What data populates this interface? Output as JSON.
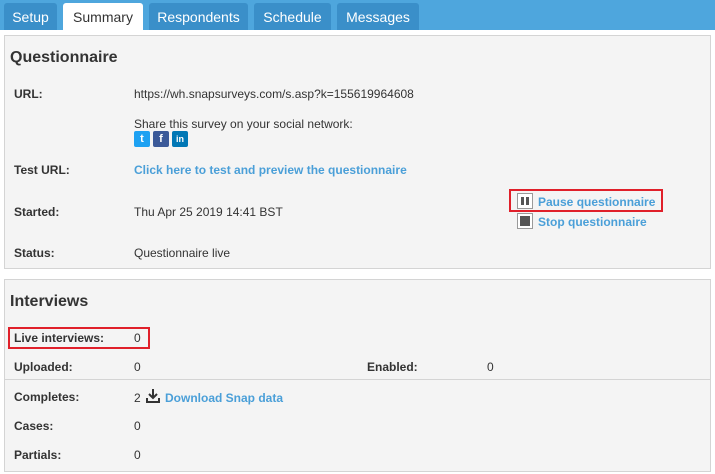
{
  "tabs": [
    {
      "label": "Setup"
    },
    {
      "label": "Summary"
    },
    {
      "label": "Respondents"
    },
    {
      "label": "Schedule"
    },
    {
      "label": "Messages"
    }
  ],
  "questionnaire": {
    "title": "Questionnaire",
    "url_label": "URL:",
    "url_value": "https://wh.snapsurveys.com/s.asp?k=155619964608",
    "share_text": "Share this survey on your social network:",
    "social": {
      "twitter": "t",
      "facebook": "f",
      "linkedin": "in"
    },
    "test_url_label": "Test URL:",
    "test_url_link": "Click here to test and preview the questionnaire",
    "started_label": "Started:",
    "started_value": "Thu Apr 25 2019 14:41 BST",
    "status_label": "Status:",
    "status_value": "Questionnaire live",
    "pause_label": "Pause questionnaire",
    "stop_label": "Stop questionnaire"
  },
  "interviews": {
    "title": "Interviews",
    "live_label": "Live interviews:",
    "live_value": "0",
    "uploaded_label": "Uploaded:",
    "uploaded_value": "0",
    "enabled_label": "Enabled:",
    "enabled_value": "0",
    "completes_label": "Completes:",
    "completes_value": "2",
    "download_label": "Download Snap data",
    "cases_label": "Cases:",
    "cases_value": "0",
    "partials_label": "Partials:",
    "partials_value": "0"
  },
  "colors": {
    "accent": "#4ea6dd",
    "highlight": "#e0202a",
    "link": "#4a9fd8"
  }
}
